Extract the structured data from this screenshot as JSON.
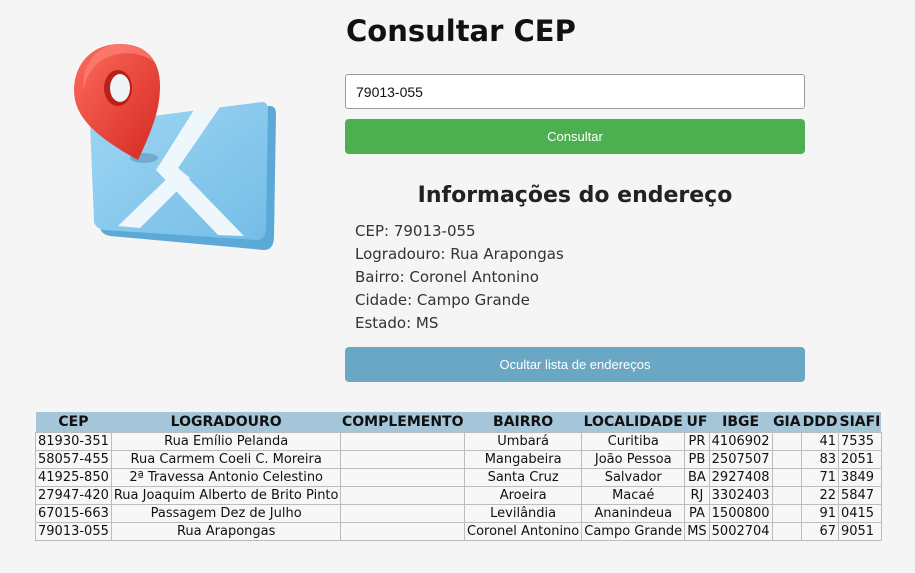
{
  "header": {
    "title": "Consultar CEP"
  },
  "search": {
    "value": "79013-055",
    "button_label": "Consultar"
  },
  "info": {
    "heading": "Informações do endereço",
    "lines": [
      "CEP: 79013-055",
      "Logradouro: Rua Arapongas",
      "Bairro: Coronel Antonino",
      "Cidade: Campo Grande",
      "Estado: MS"
    ]
  },
  "toggle_button_label": "Ocultar lista de endereços",
  "table": {
    "headers": [
      "CEP",
      "LOGRADOURO",
      "COMPLEMENTO",
      "BAIRRO",
      "LOCALIDADE",
      "UF",
      "IBGE",
      "GIA",
      "DDD",
      "SIAFI"
    ],
    "rows": [
      [
        "81930-351",
        "Rua Emílio Pelanda",
        "",
        "Umbará",
        "Curitiba",
        "PR",
        "4106902",
        "",
        "41",
        "7535"
      ],
      [
        "58057-455",
        "Rua Carmem Coeli C. Moreira",
        "",
        "Mangabeira",
        "João Pessoa",
        "PB",
        "2507507",
        "",
        "83",
        "2051"
      ],
      [
        "41925-850",
        "2ª Travessa Antonio Celestino",
        "",
        "Santa Cruz",
        "Salvador",
        "BA",
        "2927408",
        "",
        "71",
        "3849"
      ],
      [
        "27947-420",
        "Rua Joaquim Alberto de Brito Pinto",
        "",
        "Aroeira",
        "Macaé",
        "RJ",
        "3302403",
        "",
        "22",
        "5847"
      ],
      [
        "67015-663",
        "Passagem Dez de Julho",
        "",
        "Levilândia",
        "Ananindeua",
        "PA",
        "1500800",
        "",
        "91",
        "0415"
      ],
      [
        "79013-055",
        "Rua Arapongas",
        "",
        "Coronel Antonino",
        "Campo Grande",
        "MS",
        "5002704",
        "",
        "67",
        "9051"
      ]
    ]
  },
  "colors": {
    "consult_button": "#4caf50",
    "toggle_button": "#6aa7c4",
    "table_header": "#a4c6d8",
    "pin": "#e8392f",
    "map": "#8ccbee"
  },
  "icons": {
    "illustration": "map-pin-illustration"
  }
}
